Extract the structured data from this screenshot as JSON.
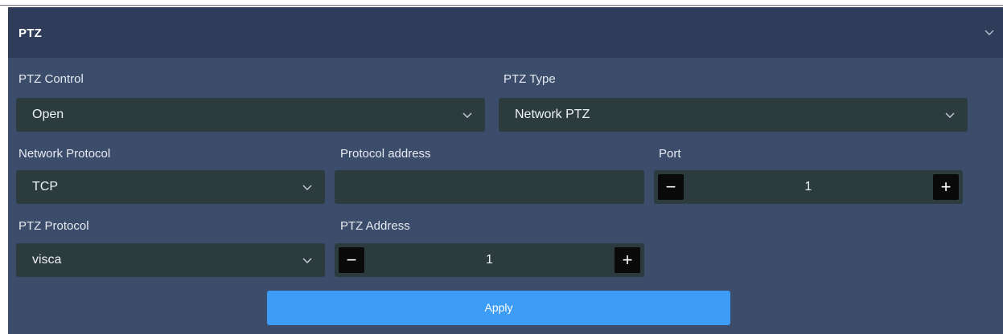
{
  "panel": {
    "title": "PTZ",
    "icon": "chevron-down-icon"
  },
  "fields": {
    "ptz_control": {
      "label": "PTZ Control",
      "value": "Open"
    },
    "ptz_type": {
      "label": "PTZ Type",
      "value": "Network PTZ"
    },
    "network_protocol": {
      "label": "Network Protocol",
      "value": "TCP"
    },
    "protocol_address": {
      "label": "Protocol address",
      "value": ""
    },
    "port": {
      "label": "Port",
      "value": "1",
      "decrement": "−",
      "increment": "+"
    },
    "ptz_protocol": {
      "label": "PTZ Protocol",
      "value": "visca"
    },
    "ptz_address": {
      "label": "PTZ Address",
      "value": "1",
      "decrement": "−",
      "increment": "+"
    }
  },
  "actions": {
    "apply_label": "Apply"
  },
  "colors": {
    "panel_bg": "#3b4d6a",
    "header_bg": "#2f3d5a",
    "field_bg": "#2b3b3e",
    "accent": "#3d9cf5"
  }
}
